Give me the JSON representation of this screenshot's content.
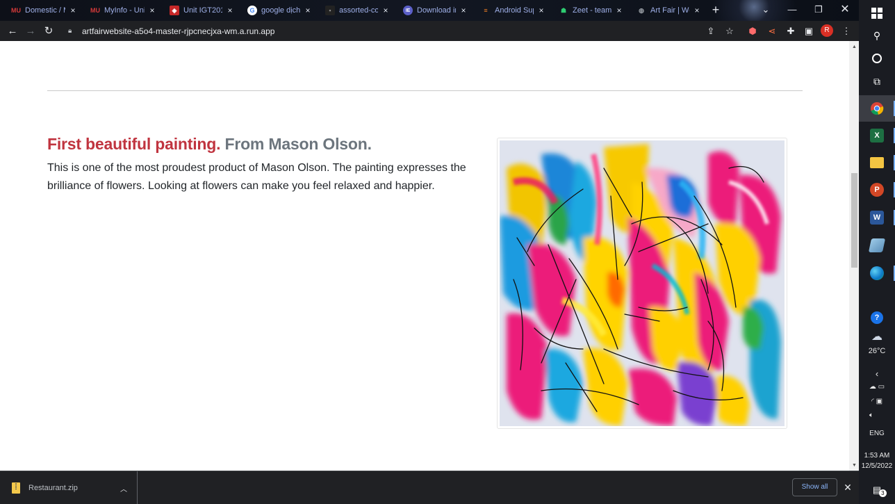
{
  "browser": {
    "tabs": [
      {
        "label": "Domestic / M",
        "favicon": "MU",
        "favicon_color": "#d63a3a"
      },
      {
        "label": "MyInfo - Uni",
        "favicon": "MU",
        "favicon_color": "#d63a3a"
      },
      {
        "label": "Unit IGT201",
        "favicon": "shield",
        "favicon_color": "#c62828"
      },
      {
        "label": "google dịch",
        "favicon": "G",
        "favicon_color": "#4285f4"
      },
      {
        "label": "assorted-col",
        "favicon": "image",
        "favicon_color": "#222"
      },
      {
        "label": "Download im",
        "favicon": "IE",
        "favicon_color": "#5b5fc7"
      },
      {
        "label": "Android Sup",
        "favicon": "stack",
        "favicon_color": "#f48024"
      },
      {
        "label": "Zeet - team-",
        "favicon": "robot",
        "favicon_color": "#2ecc71"
      },
      {
        "label": "Art Fair | Wel",
        "favicon": "globe",
        "favicon_color": "#9aa0a6"
      }
    ],
    "new_tab": "+",
    "url": "artfairwebsite-a5o4-master-rjpcnecjxa-wm.a.run.app",
    "profile_initial": "R"
  },
  "page": {
    "headline_accent": "First beautiful painting.",
    "headline_rest": " From Mason Olson.",
    "description": "This is one of the most proudest product of Mason Olson. The painting expresses the brilliance of flowers. Looking at flowers can make you feel relaxed and happier.",
    "accent_color": "#c0343f",
    "muted_color": "#6c757d"
  },
  "downloads": {
    "file_name": "Restaurant.zip",
    "show_all": "Show all"
  },
  "taskbar": {
    "weather_temp": "26°C",
    "language": "ENG",
    "time": "1:53 AM",
    "date": "12/5/2022",
    "notification_count": "3"
  }
}
